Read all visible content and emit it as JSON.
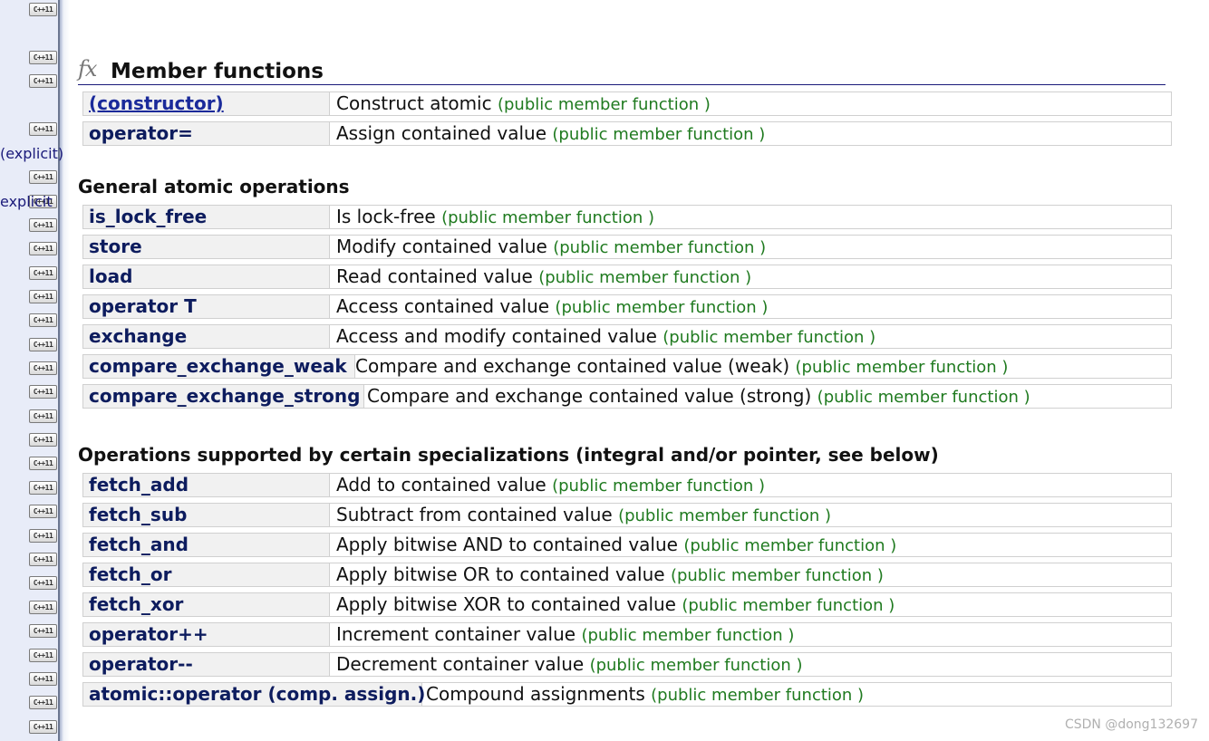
{
  "sidebar": {
    "badge_label": "C++11",
    "words": [
      "(explicit)",
      "explicit"
    ]
  },
  "header": {
    "icon": "fx",
    "title": "Member functions"
  },
  "kind_label": "(public member function )",
  "sections": [
    {
      "heading": "",
      "rows": [
        {
          "name": "(constructor)",
          "desc": "Construct atomic"
        },
        {
          "name": "operator=",
          "desc": "Assign contained value"
        }
      ]
    },
    {
      "heading": "General atomic operations",
      "rows": [
        {
          "name": "is_lock_free",
          "desc": "Is lock-free"
        },
        {
          "name": "store",
          "desc": "Modify contained value"
        },
        {
          "name": "load",
          "desc": "Read contained value"
        },
        {
          "name": "operator T",
          "desc": "Access contained value"
        },
        {
          "name": "exchange",
          "desc": "Access and modify contained value"
        },
        {
          "name": "compare_exchange_weak",
          "desc": "Compare and exchange contained value (weak)"
        },
        {
          "name": "compare_exchange_strong",
          "desc": "Compare and exchange contained value (strong)"
        }
      ]
    },
    {
      "heading": "Operations supported by certain specializations (integral and/or pointer, see below)",
      "rows": [
        {
          "name": "fetch_add",
          "desc": "Add to contained value"
        },
        {
          "name": "fetch_sub",
          "desc": "Subtract from contained value"
        },
        {
          "name": "fetch_and",
          "desc": "Apply bitwise AND to contained value"
        },
        {
          "name": "fetch_or",
          "desc": "Apply bitwise OR to contained value"
        },
        {
          "name": "fetch_xor",
          "desc": "Apply bitwise XOR to contained value"
        },
        {
          "name": "operator++",
          "desc": "Increment container value"
        },
        {
          "name": "operator--",
          "desc": "Decrement container value"
        },
        {
          "name": "atomic::operator (comp. assign.)",
          "desc": "Compound assignments"
        }
      ]
    }
  ],
  "watermark": "CSDN @dong132697",
  "colors": {
    "name_text": "#0d1c5e",
    "kind_text": "#1f7a1f",
    "rule": "#1a1a7a"
  }
}
